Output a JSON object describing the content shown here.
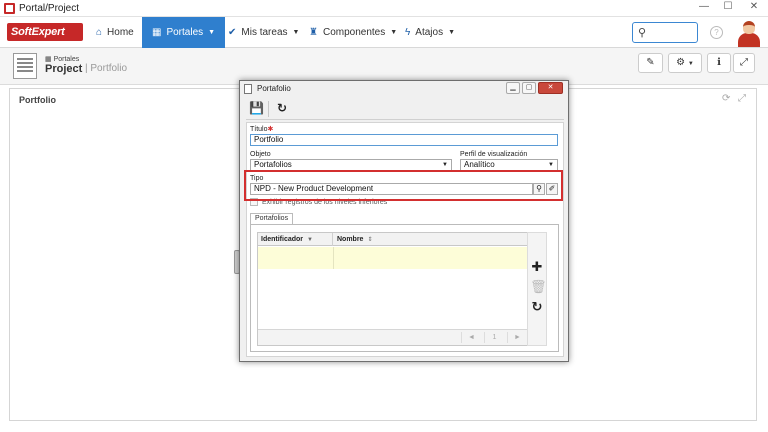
{
  "window": {
    "title": "Portal/Project",
    "min": "—",
    "max": "☐",
    "close": "✕"
  },
  "brand": {
    "logo_text": "SoftExpert"
  },
  "nav": {
    "home": "Home",
    "portales": "Portales",
    "mis_tareas": "Mis tareas",
    "componentes": "Componentes",
    "atajos": "Atajos"
  },
  "breadcrumb": {
    "section": "Portales",
    "title": "Project",
    "sub": "| Portfolio"
  },
  "panel": {
    "title": "Portfolio"
  },
  "dialog": {
    "title": "Portafolio",
    "fields": {
      "titulo_label": "Título",
      "titulo_value": "Portfolio",
      "objeto_label": "Objeto",
      "objeto_value": "Portafolios",
      "perfil_label": "Perfil de visualización",
      "perfil_value": "Analítico",
      "tipo_label": "Tipo",
      "tipo_value": "NPD - New Product Development",
      "checkbox_label": "Exhibir registros de los niveles inferiores"
    },
    "tab": "Portafolios",
    "grid": {
      "columns": [
        "Identificador",
        "Nombre"
      ],
      "pager": {
        "prev": "◄",
        "page": "1",
        "next": "►"
      }
    }
  },
  "colors": {
    "accent": "#2f7fce",
    "brand": "#c62828",
    "highlight": "#d32f2f",
    "selected_row": "#fdfdd8"
  }
}
